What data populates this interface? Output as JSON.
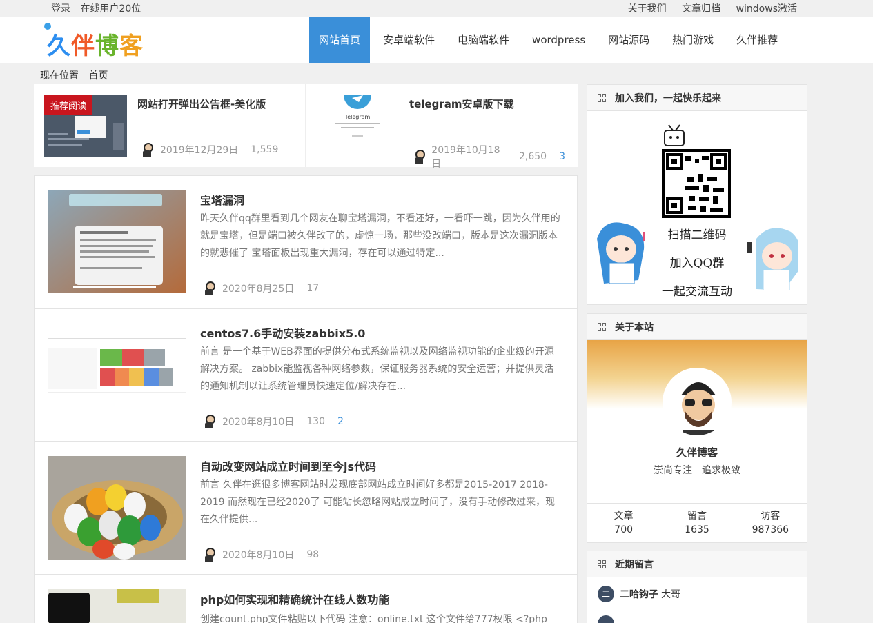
{
  "topbar": {
    "login": "登录",
    "online": "在线用户20位",
    "links": [
      "关于我们",
      "文章归档",
      "windows激活"
    ]
  },
  "logo": {
    "text": [
      "久",
      "伴",
      "博",
      "客"
    ]
  },
  "nav": {
    "items": [
      "网站首页",
      "安卓端软件",
      "电脑端软件",
      "wordpress",
      "网站源码",
      "热门游戏",
      "久伴推荐"
    ]
  },
  "breadcrumb": {
    "label": "现在位置",
    "current": "首页"
  },
  "featured": [
    {
      "badge": "推荐阅读",
      "title": "网站打开弹出公告框-美化版",
      "date": "2019年12月29日",
      "views": "1,559",
      "comments": ""
    },
    {
      "title": "telegram安卓版下载",
      "date": "2019年10月18日",
      "views": "2,650",
      "comments": "3",
      "thumb_text": "Telegram"
    }
  ],
  "posts": [
    {
      "title": "宝塔漏洞",
      "desc": "昨天久伴qq群里看到几个网友在聊宝塔漏洞，不看还好，一看吓一跳，因为久伴用的就是宝塔，但是端口被久伴改了的，虚惊一场，那些没改端口，版本是这次漏洞版本的就悲催了 宝塔面板出现重大漏洞，存在可以通过特定...",
      "date": "2020年8月25日",
      "views": "17",
      "comments": ""
    },
    {
      "title": "centos7.6手动安装zabbix5.0",
      "desc": "前言  是一个基于WEB界面的提供分布式系统监视以及网络监视功能的企业级的开源解决方案。 zabbix能监视各种网络参数，保证服务器系统的安全运营；并提供灵活的通知机制以让系统管理员快速定位/解决存在...",
      "date": "2020年8月10日",
      "views": "130",
      "comments": "2"
    },
    {
      "title": "自动改变网站成立时间到至今js代码",
      "desc": "前言  久伴在逛很多博客网站时发现底部网站成立时间好多都是2015-2017 2018-2019 而然现在已经2020了 可能站长忽略网站成立时间了，没有手动修改过来，现在久伴提供...",
      "date": "2020年8月10日",
      "views": "98",
      "comments": ""
    },
    {
      "title": "php如何实现和精确统计在线人数功能",
      "desc": "创建count.php文件粘贴以下代码 注意：online.txt 这个文件给777权限 <?php",
      "date": "",
      "views": "",
      "comments": ""
    }
  ],
  "sidebar": {
    "join": {
      "title": "加入我们，一起快乐起来",
      "lines": [
        "扫描二维码",
        "加入QQ群",
        "一起交流互动"
      ]
    },
    "about": {
      "title": "关于本站",
      "name": "久伴博客",
      "slogan": "崇尚专注　追求极致",
      "stats": [
        {
          "label": "文章",
          "value": "700"
        },
        {
          "label": "留言",
          "value": "1635"
        },
        {
          "label": "访客",
          "value": "987366"
        }
      ]
    },
    "comments": {
      "title": "近期留言",
      "items": [
        {
          "user": "二哈钩子",
          "text": "大哥"
        }
      ]
    }
  },
  "colors": {
    "accent": "#3a8fd9",
    "badge": "#c9151e"
  }
}
